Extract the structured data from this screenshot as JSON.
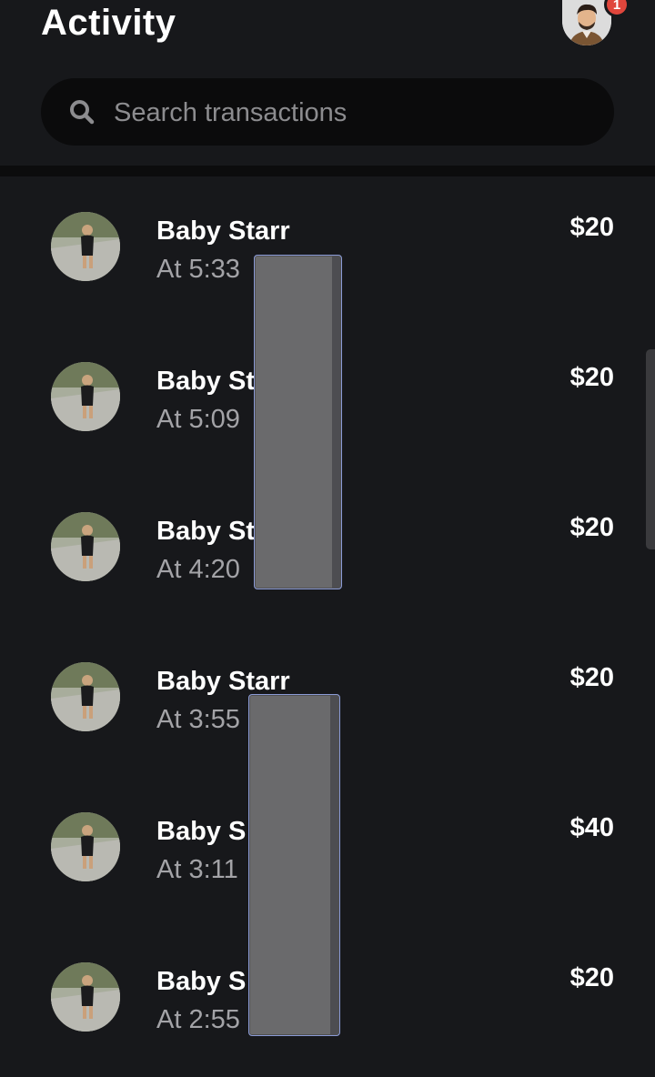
{
  "header": {
    "title": "Activity",
    "notification_count": "1"
  },
  "search": {
    "placeholder": "Search transactions"
  },
  "transactions": [
    {
      "name": "Baby Starr",
      "time": "At 5:33",
      "amount": "$20"
    },
    {
      "name": "Baby St",
      "time": "At 5:09",
      "amount": "$20"
    },
    {
      "name": "Baby St",
      "time": "At 4:20",
      "amount": "$20"
    },
    {
      "name": "Baby Starr",
      "time": "At 3:55",
      "amount": "$20"
    },
    {
      "name": "Baby S",
      "time": "At 3:11",
      "amount": "$40"
    },
    {
      "name": "Baby S",
      "time": "At 2:55",
      "amount": "$20"
    }
  ],
  "colors": {
    "background": "#17181b",
    "search_bg": "#0b0b0c",
    "badge": "#e0463c",
    "secondary_text": "#a3a3a7"
  }
}
